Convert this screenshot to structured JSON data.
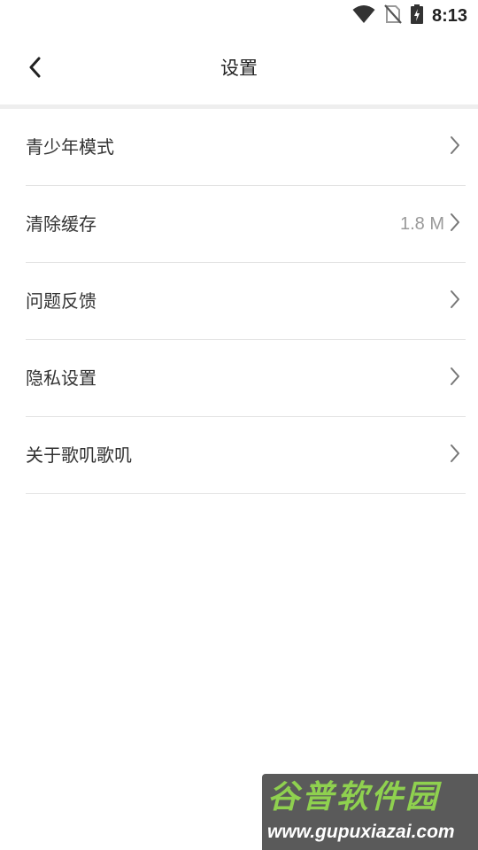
{
  "status_bar": {
    "time": "8:13",
    "icons": [
      "wifi-icon",
      "no-sim-icon",
      "battery-charging-icon"
    ]
  },
  "header": {
    "title": "设置",
    "back_icon": "chevron-left-icon"
  },
  "settings": {
    "items": [
      {
        "label": "青少年模式",
        "value": ""
      },
      {
        "label": "清除缓存",
        "value": "1.8 M"
      },
      {
        "label": "问题反馈",
        "value": ""
      },
      {
        "label": "隐私设置",
        "value": ""
      },
      {
        "label": "关于歌叽歌叽",
        "value": ""
      }
    ],
    "chevron_icon": "chevron-right-icon"
  },
  "watermark": {
    "title": "谷普软件园",
    "url": "www.gupuxiazai.com"
  },
  "colors": {
    "background": "#ffffff",
    "divider": "#e3e3e3",
    "header_divider": "#eeeeee",
    "text_primary": "#333333",
    "text_secondary": "#999999"
  }
}
